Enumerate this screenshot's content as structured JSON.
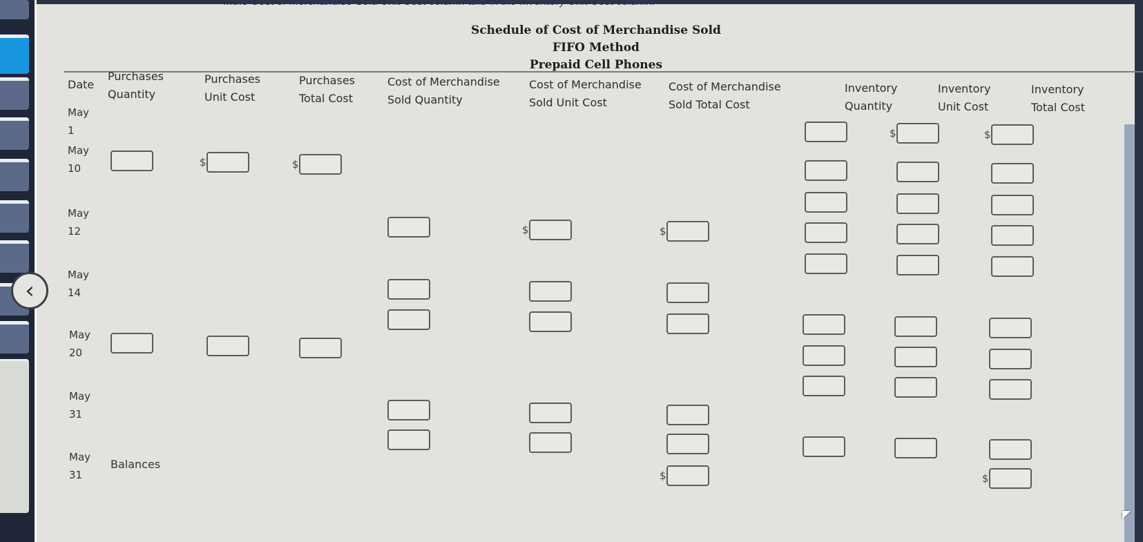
{
  "instruction_text": "...the Cost of Merchandise Sold Unit Cost column and in the Inventory Unit Cost column.",
  "title": {
    "line1": "Schedule of Cost of Merchandise Sold",
    "line2": "FIFO Method",
    "line3": "Prepaid Cell Phones"
  },
  "columns": [
    {
      "key": "date",
      "line1": "Date",
      "line2": ""
    },
    {
      "key": "pq",
      "line1": "Purchases",
      "line2": "Quantity"
    },
    {
      "key": "puc",
      "line1": "Purchases",
      "line2": "Unit Cost"
    },
    {
      "key": "ptc",
      "line1": "Purchases",
      "line2": "Total Cost"
    },
    {
      "key": "cq",
      "line1": "Cost of Merchandise",
      "line2": "Sold Quantity"
    },
    {
      "key": "cuc",
      "line1": "Cost of Merchandise",
      "line2": "Sold Unit Cost"
    },
    {
      "key": "ctc",
      "line1": "Cost of Merchandise",
      "line2": "Sold Total Cost"
    },
    {
      "key": "iq",
      "line1": "Inventory",
      "line2": "Quantity"
    },
    {
      "key": "iuc",
      "line1": "Inventory",
      "line2": "Unit Cost"
    },
    {
      "key": "itc",
      "line1": "Inventory",
      "line2": "Total Cost"
    }
  ],
  "rows": [
    {
      "month": "May",
      "day": "1"
    },
    {
      "month": "May",
      "day": "10"
    },
    {
      "month": "May",
      "day": "12"
    },
    {
      "month": "May",
      "day": "14"
    },
    {
      "month": "May",
      "day": "20"
    },
    {
      "month": "May",
      "day": "31"
    },
    {
      "month": "May",
      "day": "31",
      "label": "Balances"
    }
  ],
  "currency_symbol": "$",
  "inputs": {
    "may1": {
      "iq": [
        ""
      ],
      "iuc": [
        ""
      ],
      "itc": [
        ""
      ]
    },
    "may10": {
      "pq": [
        ""
      ],
      "puc": [
        ""
      ],
      "ptc": [
        ""
      ],
      "iq": [
        "",
        ""
      ],
      "iuc": [
        "",
        ""
      ],
      "itc": [
        "",
        ""
      ]
    },
    "may12": {
      "cq": [
        ""
      ],
      "cuc": [
        ""
      ],
      "ctc": [
        ""
      ],
      "iq": [
        "",
        ""
      ],
      "iuc": [
        "",
        ""
      ],
      "itc": [
        "",
        ""
      ]
    },
    "may14": {
      "cq": [
        "",
        ""
      ],
      "cuc": [
        "",
        ""
      ],
      "ctc": [
        "",
        ""
      ]
    },
    "may20": {
      "pq": [
        ""
      ],
      "puc": [
        ""
      ],
      "ptc": [
        ""
      ],
      "iq": [
        "",
        "",
        ""
      ],
      "iuc": [
        "",
        "",
        ""
      ],
      "itc": [
        "",
        "",
        ""
      ]
    },
    "may31": {
      "cq": [
        "",
        ""
      ],
      "cuc": [
        "",
        ""
      ],
      "ctc": [
        "",
        ""
      ],
      "iq": [
        ""
      ],
      "iuc": [
        ""
      ],
      "itc": [
        ""
      ]
    },
    "balances": {
      "ctc": [
        ""
      ],
      "itc": [
        ""
      ]
    }
  },
  "back_button_icon": "chevron-left-icon"
}
